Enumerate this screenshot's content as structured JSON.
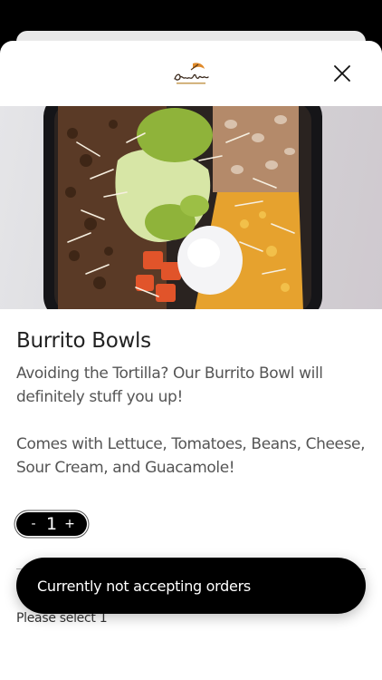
{
  "brand": {
    "logo_text": "Burrito Loco",
    "logo_tagline": "AUTHENTIC MEXICAN CUISINE"
  },
  "header": {
    "close_icon": "close-icon"
  },
  "item": {
    "title": "Burrito Bowls",
    "description_lines": [
      "Avoiding the Tortilla? Our Burrito Bowl will definitely stuff you up!",
      "Comes with Lettuce, Tomatoes, Beans, Cheese, Sour Cream, and Guacamole!"
    ],
    "image_subject": "burrito bowl with beef, rice, beans, cheese, lettuce, guacamole, tomatoes and sour cream"
  },
  "quantity": {
    "decrement_label": "-",
    "value": "1",
    "increment_label": "+"
  },
  "options_section": {
    "hint": "Please select 1"
  },
  "toast": {
    "message": "Currently not accepting orders"
  },
  "colors": {
    "background": "#000000",
    "sheet": "#ffffff",
    "toast": "#000000",
    "accent_red": "#d0202a"
  }
}
